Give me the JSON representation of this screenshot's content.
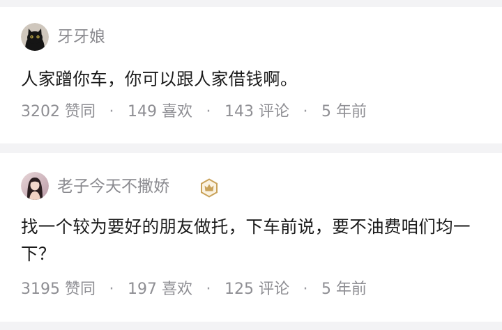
{
  "separator_symbol": "·",
  "answers": [
    {
      "author": "牙牙娘",
      "avatar_icon": "black-cat-avatar",
      "text": "人家蹭你车，你可以跟人家借钱啊。",
      "likes": "3202 赞同",
      "favorites": "149 喜欢",
      "comments": "143 评论",
      "time": "5 年前"
    },
    {
      "author": "老子今天不撒娇",
      "avatar_icon": "girl-photo-avatar",
      "badge_icon": "crown-badge-icon",
      "badge_color": "#c9a25a",
      "text": "找一个较为要好的朋友做托，下车前说，要不油费咱们均一下？",
      "likes": "3195 赞同",
      "favorites": "197 喜欢",
      "comments": "125 评论",
      "time": "5 年前"
    }
  ]
}
